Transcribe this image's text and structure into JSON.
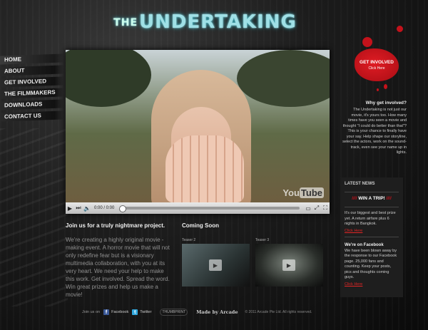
{
  "logo": {
    "the": "THE",
    "main": "UNDERTAKING"
  },
  "nav": {
    "items": [
      {
        "label": "HOME"
      },
      {
        "label": "ABOUT"
      },
      {
        "label": "GET INVOLVED"
      },
      {
        "label": "THE FILMMAKERS"
      },
      {
        "label": "DOWNLOADS"
      },
      {
        "label": "CONTACT US"
      }
    ]
  },
  "video": {
    "time": "0:00 / 0:00",
    "watermark_you": "You",
    "watermark_tube": "Tube",
    "icons": [
      "play-icon",
      "skip-icon",
      "volume-icon",
      "quality-icon",
      "expand-icon",
      "fullscreen-icon"
    ]
  },
  "intro": {
    "heading": "Join us for a truly nightmare project.",
    "body": "We're creating a highly original movie -making event. A horror movie that will not only redefine fear but is a visionary multimedia collaboration, with you at its very heart. We need your help to make this work. Get involved. Spread the word. Win great prizes and help us make a movie!"
  },
  "coming_soon": {
    "heading": "Coming Soon",
    "teasers": [
      {
        "label": "Teaser 2"
      },
      {
        "label": "Teaser 3"
      }
    ]
  },
  "get_involved_button": {
    "title": "GET INVOLVED",
    "sub": "Click Here",
    "color": "#c3121b"
  },
  "why": {
    "heading": "Why get involved?",
    "body": "The Undertaking is not just our movie, it's yours too. How many times have you seen a movie and thought \"I could do better than that\"? This is your chance to finally have your say. Help shape our storyline, select the actors, work on the sound-track, even see your name up in lights."
  },
  "news": {
    "heading": "LATEST NEWS",
    "win_text": "WIN A TRIP!",
    "win_slash": "////",
    "item1": "It's our biggest and best prize yet. A return airfare plus 6 nights in Bangkok.",
    "item1_link": "Click Here",
    "item2_heading": "We're on Facebook",
    "item2": "We have been blown away by the response to our Facebook page. 25,000 fans and counting. Keep your posts, pics and thoughts coming guys.",
    "item2_link": "Click Here"
  },
  "footer": {
    "join": "Join us on",
    "facebook": "Facebook",
    "twitter": "Twitter",
    "thumbprint": "THUMBPRINT",
    "arcade": "Made by Arcade",
    "copyright": "© 2011 Arcade Pte Ltd. All rights reserved."
  }
}
